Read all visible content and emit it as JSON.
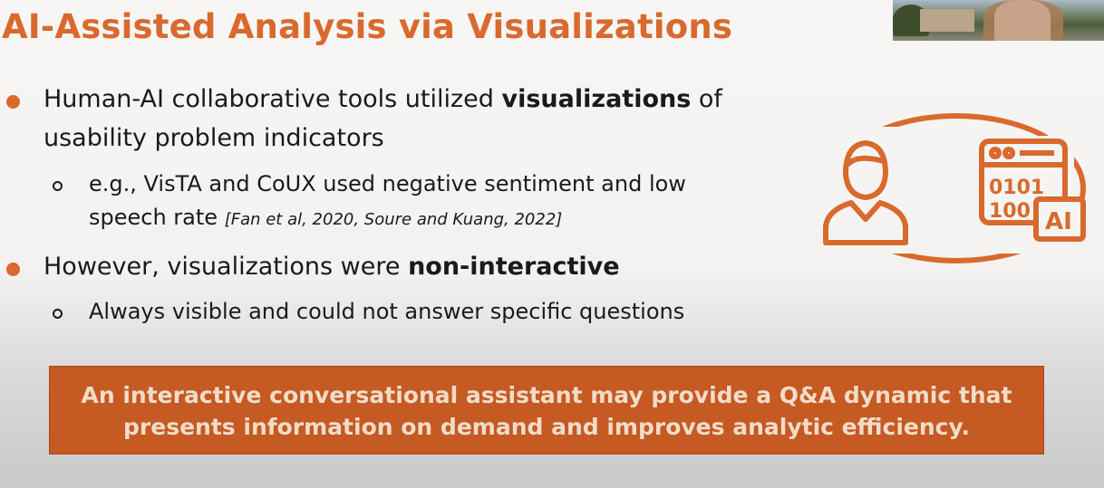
{
  "slide": {
    "title": "AI-Assisted Analysis via Visualizations",
    "bullets": [
      {
        "pre": "Human-AI collaborative tools utilized ",
        "bold": "visualizations",
        "post_line1": " of",
        "line2": "usability problem indicators"
      },
      {
        "pre": "However, visualizations were ",
        "bold": "non-interactive"
      }
    ],
    "sub_bullets": [
      {
        "line1": "e.g., VisTA and CoUX used negative sentiment and low",
        "line2": "speech rate ",
        "citation": "[Fan et al, 2020, Soure and Kuang, 2022]"
      },
      {
        "line1": "Always visible and could not answer specific questions"
      }
    ],
    "callout": {
      "line1": "An interactive conversational assistant may provide a Q&A dynamic that",
      "line2": "presents information on demand and improves analytic efficiency."
    },
    "illustration": {
      "icons": [
        "person-icon",
        "computer-window-icon"
      ],
      "binary_row1": "0101",
      "binary_row2": "100",
      "ai_badge": "AI",
      "accent": "#d9692d"
    }
  },
  "colors": {
    "accent": "#d9692d",
    "callout_bg": "#c55a22",
    "callout_text": "#f2dcc9",
    "text": "#1a1a1a"
  }
}
